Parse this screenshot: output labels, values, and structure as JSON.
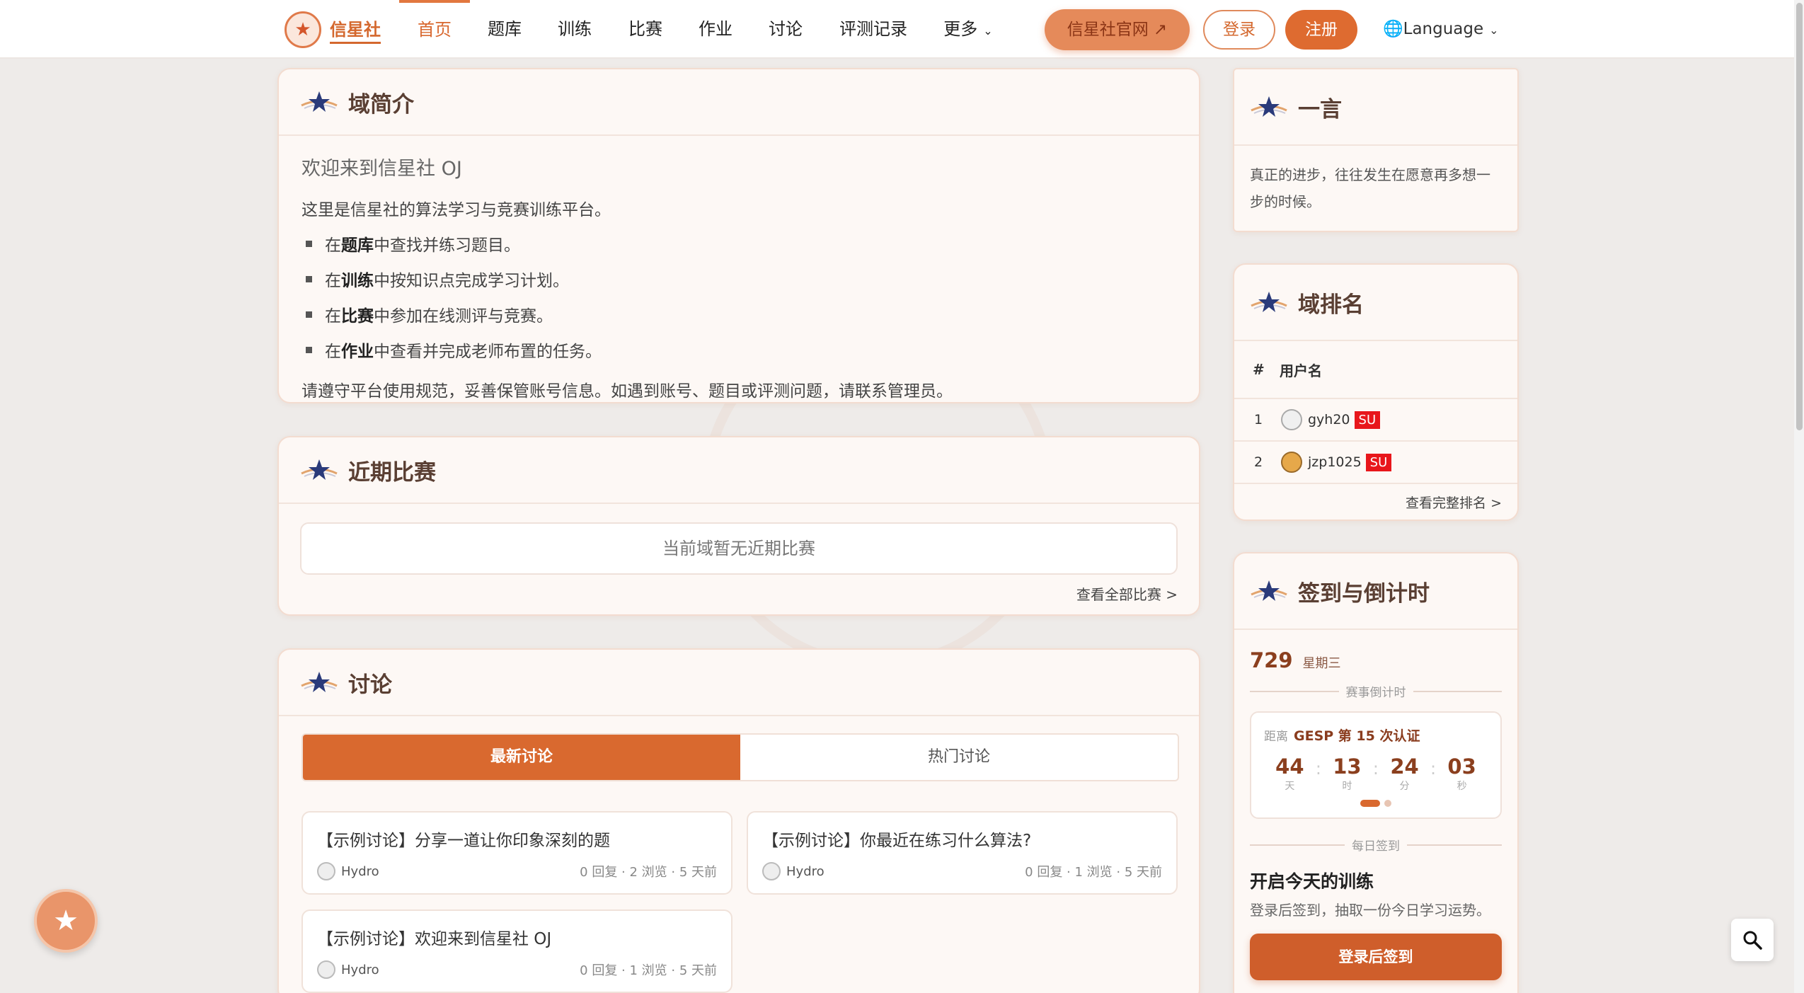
{
  "brand": {
    "name": "信星社"
  },
  "nav": {
    "items": [
      {
        "label": "首页"
      },
      {
        "label": "题库"
      },
      {
        "label": "训练"
      },
      {
        "label": "比赛"
      },
      {
        "label": "作业"
      },
      {
        "label": "讨论"
      },
      {
        "label": "评测记录"
      },
      {
        "label": "更多"
      }
    ],
    "official": "信星社官网 ↗",
    "login": "登录",
    "register": "注册",
    "language": "Language"
  },
  "intro": {
    "title": "域简介",
    "welcome": "欢迎来到信星社 OJ",
    "line1": "这里是信星社的算法学习与竞赛训练平台。",
    "bullets": [
      {
        "pre": "在 ",
        "bold": "题库",
        "post": " 中查找并练习题目。"
      },
      {
        "pre": "在 ",
        "bold": "训练",
        "post": " 中按知识点完成学习计划。"
      },
      {
        "pre": "在 ",
        "bold": "比赛",
        "post": " 中参加在线测评与竞赛。"
      },
      {
        "pre": "在 ",
        "bold": "作业",
        "post": " 中查看并完成老师布置的任务。"
      }
    ],
    "line2": "请遵守平台使用规范，妥善保管账号信息。如遇到账号、题目或评测问题，请联系管理员。"
  },
  "contests": {
    "title": "近期比赛",
    "empty": "当前域暂无近期比赛",
    "more": "查看全部比赛 >"
  },
  "discussion": {
    "title": "讨论",
    "tabs": [
      "最新讨论",
      "热门讨论"
    ],
    "items": [
      {
        "title": "【示例讨论】分享一道让你印象深刻的题",
        "author": "Hydro",
        "stats": "0 回复 · 2 浏览 · 5 天前"
      },
      {
        "title": "【示例讨论】你最近在练习什么算法?",
        "author": "Hydro",
        "stats": "0 回复 · 1 浏览 · 5 天前"
      },
      {
        "title": "【示例讨论】欢迎来到信星社 OJ",
        "author": "Hydro",
        "stats": "0 回复 · 1 浏览 · 5 天前"
      }
    ]
  },
  "quote": {
    "title": "一言",
    "text": "真正的进步，往往发生在愿意再多想一步的时候。"
  },
  "ranking": {
    "title": "域排名",
    "col_rank": "#",
    "col_user": "用户名",
    "rows": [
      {
        "rank": "1",
        "user": "gyh20",
        "badge": "SU"
      },
      {
        "rank": "2",
        "user": "jzp1025",
        "badge": "SU"
      }
    ],
    "more": "查看完整排名 >"
  },
  "checkin": {
    "title": "签到与倒计时",
    "date": "729",
    "weekday": "星期三",
    "countdown_label": "赛事倒计时",
    "event_prefix": "距离",
    "event": "GESP 第 15 次认证",
    "units": [
      {
        "val": "44",
        "lbl": "天"
      },
      {
        "val": "13",
        "lbl": "时"
      },
      {
        "val": "24",
        "lbl": "分"
      },
      {
        "val": "03",
        "lbl": "秒"
      }
    ],
    "daily_label": "每日签到",
    "headline": "开启今天的训练",
    "sub": "登录后签到，抽取一份今日学习运势。",
    "button": "登录后签到"
  }
}
